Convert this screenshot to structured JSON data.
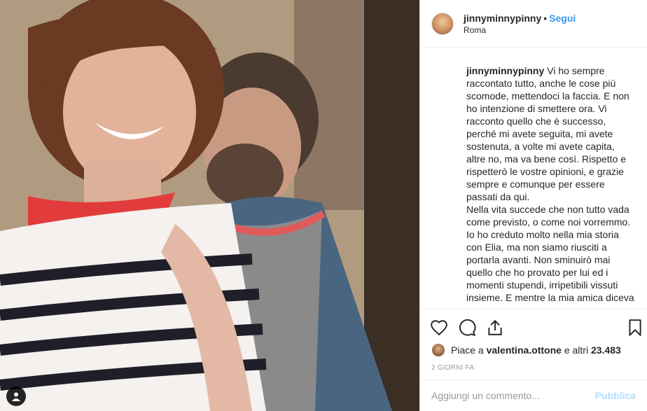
{
  "post": {
    "username": "jinnyminnypinny",
    "follow_label": "Segui",
    "separator": "•",
    "location": "Roma"
  },
  "caption": {
    "username": "jinnyminnypinny",
    "text": "Vi ho sempre raccontato tutto, anche le cose più scomode, mettendoci la faccia. E non ho intenzione di smettere ora. Vi racconto quello che è successo, perché mi avete seguita, mi avete sostenuta, a volte mi avete capita, altre no, ma va bene così. Rispetto e rispetterò le vostre opinioni, e grazie sempre e comunque per essere passati da qui.\nNella vita succede che non tutto vada come previsto, o come noi vorremmo. Io ho creduto molto nella mia storia con Elia, ma non siamo riusciti a portarla avanti. Non sminuirò mai quello che ho provato per lui ed i momenti stupendi, irripetibili vissuti insieme. E mentre la mia amica diceva"
  },
  "likes": {
    "prefix": "Piace a",
    "user": "valentina.ottone",
    "middle": "e altri",
    "count": "23.483"
  },
  "timestamp": "2 GIORNI FA",
  "comment": {
    "placeholder": "Aggiungi un commento...",
    "publish_label": "Pubblica"
  },
  "icons": {
    "like": "heart-icon",
    "comment": "comment-icon",
    "share": "share-icon",
    "save": "bookmark-icon",
    "tag": "user-tag-icon"
  }
}
